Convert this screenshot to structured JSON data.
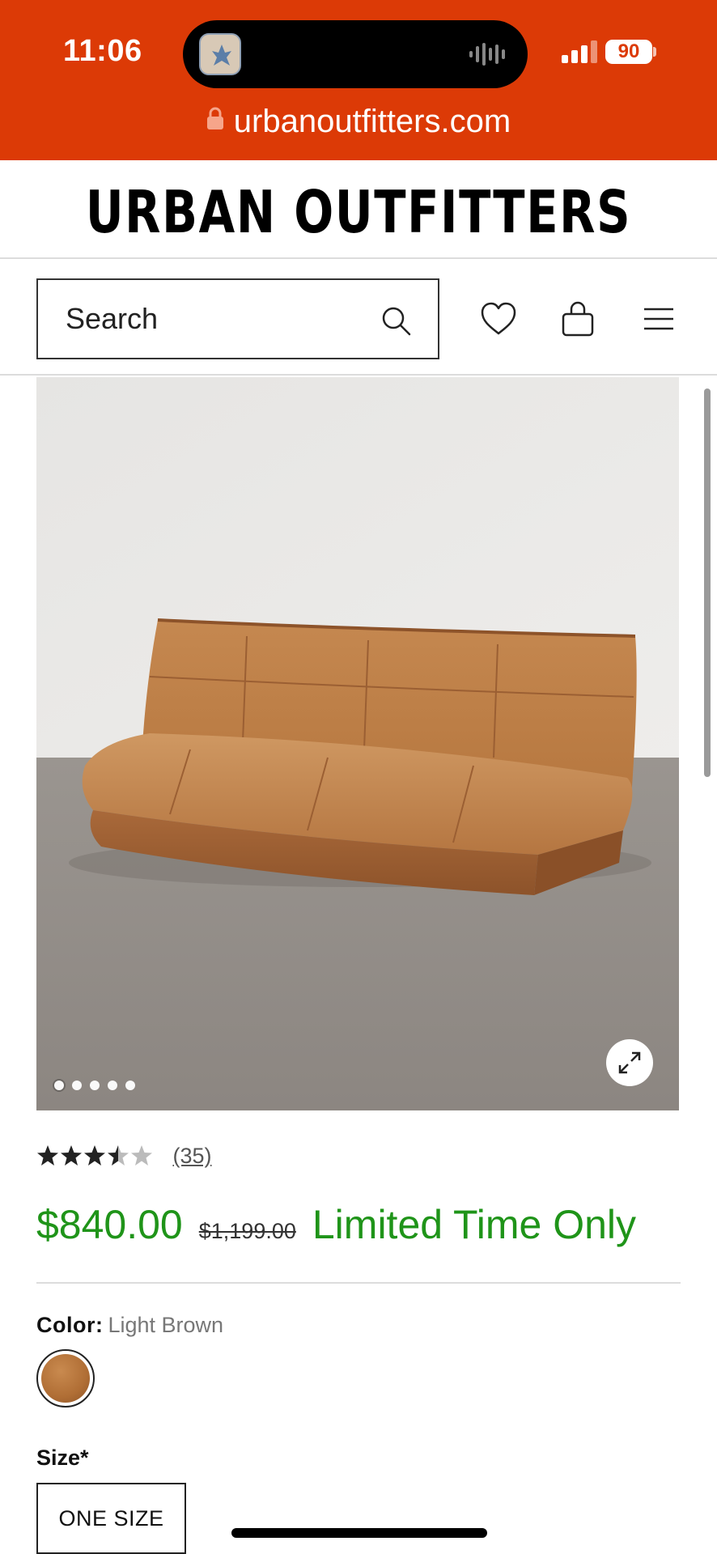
{
  "status_bar": {
    "time": "11:06",
    "battery": "90",
    "url": "urbanoutfitters.com",
    "background": "#dc3a06"
  },
  "header": {
    "logo": "URBAN OUTFITTERS"
  },
  "search": {
    "placeholder": "Search"
  },
  "nav": {
    "icons": [
      "heart-icon",
      "bag-icon",
      "menu-icon"
    ]
  },
  "gallery": {
    "slide_count": 5,
    "active_slide": 1
  },
  "product": {
    "rating": 3.5,
    "review_count": "(35)",
    "price_sale": "$840.00",
    "price_original": "$1,199.00",
    "promo": "Limited Time Only",
    "price_color": "#1f9419"
  },
  "options": {
    "color_label": "Color:",
    "color_value": "Light Brown",
    "size_label": "Size*",
    "size_value": "ONE SIZE"
  }
}
